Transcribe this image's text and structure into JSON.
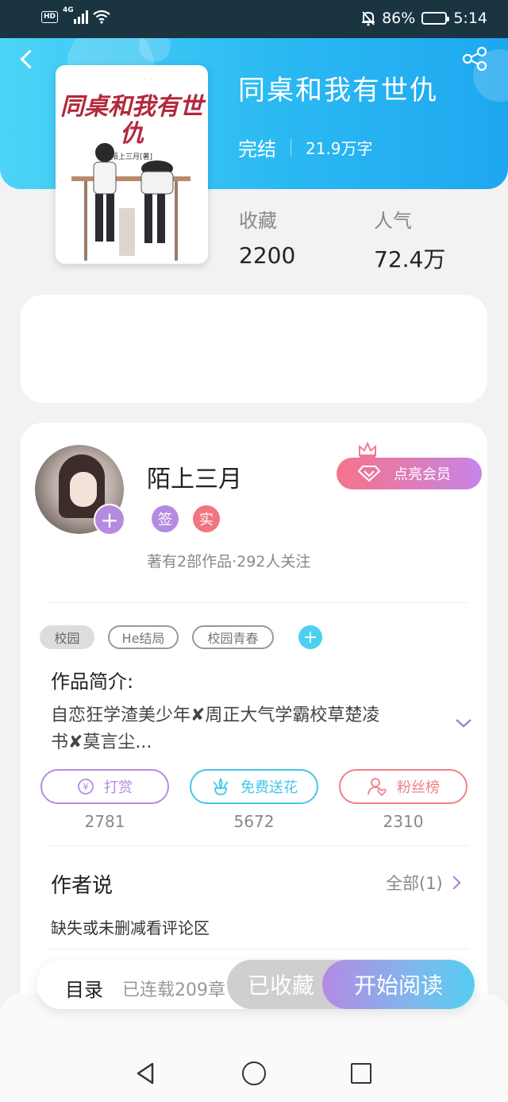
{
  "status_bar": {
    "hd": "HD",
    "network": "4G",
    "battery": "86%",
    "battery_level": 0.86,
    "time": "5:14"
  },
  "book": {
    "title": "同桌和我有世仇",
    "status": "完结",
    "word_count": "21.9万字",
    "cover": {
      "title": "同桌和我有世仇",
      "author_line": "陌上三月[著]"
    },
    "stats": [
      {
        "label": "收藏",
        "value": "2200"
      },
      {
        "label": "人气",
        "value": "72.4万"
      }
    ]
  },
  "author": {
    "name": "陌上三月",
    "badges": [
      {
        "text": "签",
        "color": "#b58be0"
      },
      {
        "text": "实",
        "color": "#f0767f"
      }
    ],
    "summary": "著有2部作品·292人关注",
    "vip_button": "点亮会员"
  },
  "tags": [
    "校园",
    "He结局",
    "校园青春"
  ],
  "intro": {
    "title": "作品简介:",
    "text": "自恋狂学渣美少年✘周正大气学霸校草楚凌书✘莫言尘..."
  },
  "actions": [
    {
      "label": "打赏",
      "count": "2781",
      "color": "#b58be0",
      "icon": "coin-icon"
    },
    {
      "label": "免费送花",
      "count": "5672",
      "color": "#45c5ec",
      "icon": "flower-icon"
    },
    {
      "label": "粉丝榜",
      "count": "2310",
      "color": "#ef8088",
      "icon": "fan-icon"
    }
  ],
  "author_says": {
    "title": "作者说",
    "all_label": "全部(1)",
    "text": "缺失或未删减看评论区"
  },
  "bottom_bar": {
    "toc": "目录",
    "serial": "已连载209章",
    "favorite": "已收藏",
    "read": "开始阅读"
  },
  "colors": {
    "header_start": "#4cd4f6",
    "header_end": "#1ea7f0",
    "accent_purple": "#b58be0",
    "accent_cyan": "#4cd0f1"
  }
}
